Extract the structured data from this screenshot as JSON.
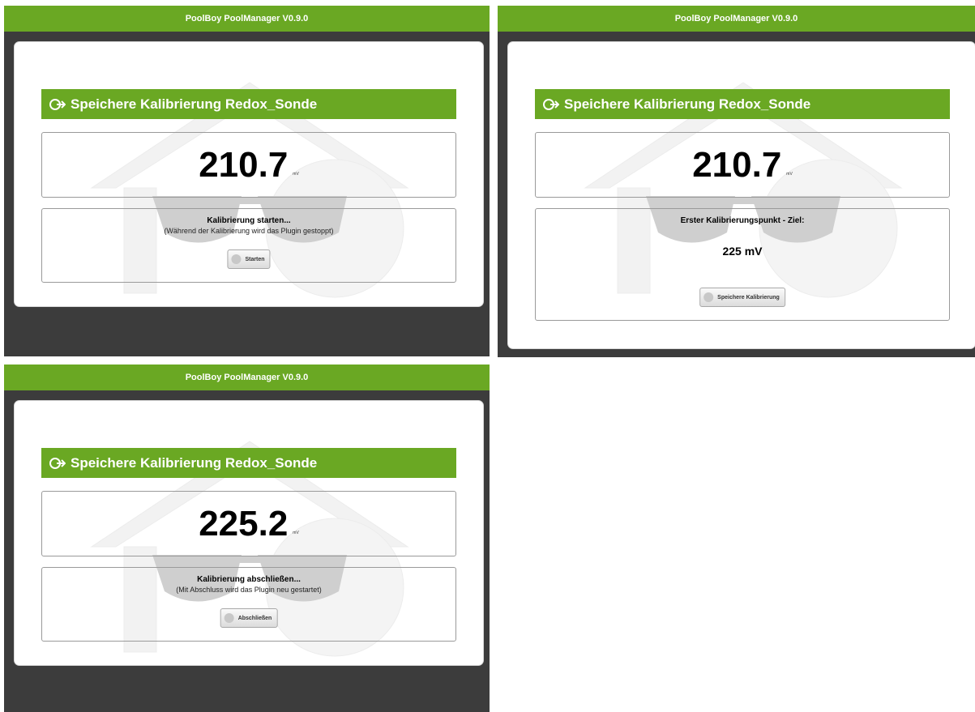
{
  "screens": [
    {
      "topbar_title": "PoolBoy PoolManager V0.9.0",
      "heading": "Speichere Kalibrierung Redox_Sonde",
      "value": "210.7",
      "unit": "mV",
      "action_title": "Kalibrierung starten...",
      "action_subtitle": "(Während der Kalibrierung wird das Plugin gestoppt)",
      "action_target": "",
      "button_label": "Starten"
    },
    {
      "topbar_title": "PoolBoy PoolManager V0.9.0",
      "heading": "Speichere Kalibrierung Redox_Sonde",
      "value": "210.7",
      "unit": "mV",
      "action_title": "Erster Kalibrierungspunkt - Ziel:",
      "action_subtitle": "",
      "action_target": "225 mV",
      "button_label": "Speichere Kalibrierung"
    },
    {
      "topbar_title": "PoolBoy PoolManager V0.9.0",
      "heading": "Speichere Kalibrierung Redox_Sonde",
      "value": "225.2",
      "unit": "mV",
      "action_title": "Kalibrierung abschließen...",
      "action_subtitle": "(Mit Abschluss wird das Plugin neu gestartet)",
      "action_target": "",
      "button_label": "Abschließen"
    }
  ],
  "colors": {
    "accent_green": "#6aa823",
    "background_dark": "#3c3c3c",
    "card_white": "#ffffff"
  },
  "icons": {
    "heading_icon": "calibrate-arrow-icon",
    "button_icon": "check-circle-icon",
    "watermark": "house-sunglasses-logo"
  }
}
